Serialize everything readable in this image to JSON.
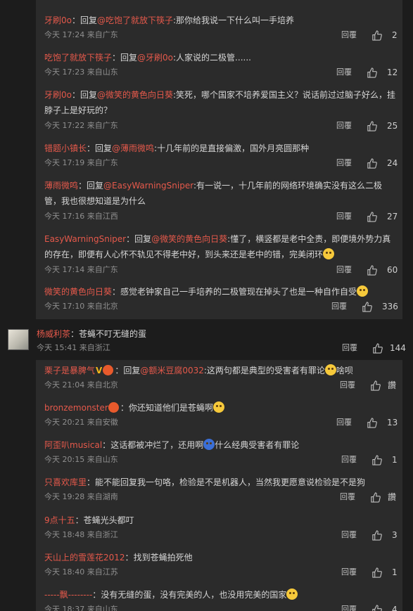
{
  "block1": {
    "replies": [
      {
        "user": "牙刷0o",
        "action": "：回复",
        "mention": "@吃饱了就放下筷子",
        "text": ":那你给我说一下什么叫一手培养",
        "time": "今天 17:24 来自广东",
        "reply_label": "回覆",
        "likes": "2"
      },
      {
        "user": "吃饱了就放下筷子",
        "action": "：回复",
        "mention": "@牙刷0o",
        "text": ":人家说的二极管......",
        "time": "今天 17:23 来自山东",
        "reply_label": "回覆",
        "likes": "12"
      },
      {
        "user": "牙刷0o",
        "action": "：回复",
        "mention": "@微笑的黄色向日葵",
        "text": ":笑死，哪个国家不培养爱国主义？说话前过过脑子好么，挂脖子上是好玩的？",
        "time": "今天 17:22 来自广东",
        "reply_label": "回覆",
        "likes": "25"
      },
      {
        "user": "错题小镇长",
        "action": "：回复",
        "mention": "@薄雨微鸣",
        "text": ":十几年前的是直接偏激，国外月亮圆那种",
        "time": "今天 17:19 来自广东",
        "reply_label": "回覆",
        "likes": "24"
      },
      {
        "user": "薄雨微鸣",
        "action": "：回复",
        "mention": "@EasyWarningSniper",
        "text": ":有一说一，十几年前的网络环境确实没有这么二极管，我也很想知道是为什么",
        "time": "今天 17:16 来自江西",
        "reply_label": "回覆",
        "likes": "27"
      },
      {
        "user": "EasyWarningSniper",
        "action": "：回复",
        "mention": "@微笑的黄色向日葵",
        "text": ":懂了，横竖都是老中全责，即便境外势力真的存在，即便有人心怀不轨见不得老中好，到头来还是老中的错，完美闭环",
        "time": "今天 17:14 来自广东",
        "reply_label": "回覆",
        "likes": "60"
      },
      {
        "user": "微笑的黄色向日葵",
        "action": "：",
        "mention": "",
        "text": "感觉老钟家自己一手培养的二极管现在掉头了也是一种自作自受",
        "time": "今天 17:10 来自北京",
        "reply_label": "回覆",
        "likes": "336"
      }
    ]
  },
  "top_comment": {
    "user": "杨威利茶",
    "text": "：苍蝇不叮无缝的蛋",
    "time": "今天 15:41 来自浙江",
    "reply_label": "回覆",
    "likes": "144"
  },
  "block2": {
    "replies": [
      {
        "user": "栗子是暴脾气",
        "action": "：回复",
        "mention": "@额米豆腐0032",
        "text": ":这两句都是典型的受害者有罪论",
        "tail": "啥呗",
        "time": "今天 21:04 来自北京",
        "reply_label": "回覆",
        "likes": "讚"
      },
      {
        "user": "bronzemonster",
        "action": "：",
        "mention": "",
        "text": "你还知道他们是苍蝇啊",
        "tail": "",
        "time": "今天 20:21 来自安徽",
        "reply_label": "回覆",
        "likes": "13"
      },
      {
        "user": "阿歪叭musical",
        "action": "：",
        "mention": "",
        "text": "这话都被冲烂了，还用啊",
        "tail": "什么经典受害者有罪论",
        "time": "今天 20:15 来自山东",
        "reply_label": "回覆",
        "likes": "1"
      },
      {
        "user": "只喜欢库里",
        "action": "：",
        "mention": "",
        "text": "能不能回复我一句咯，检验是不是机器人，当然我更愿意说检验是不是狗",
        "tail": "",
        "time": "今天 19:28 来自湖南",
        "reply_label": "回覆",
        "likes": "讚"
      },
      {
        "user": "9点十五",
        "action": "：",
        "mention": "",
        "text": "苍蝇光头都叮",
        "tail": "",
        "time": "今天 18:48 来自浙江",
        "reply_label": "回覆",
        "likes": "3"
      },
      {
        "user": "天山上的雪莲花2012",
        "action": "：",
        "mention": "",
        "text": "找到苍蝇拍死他",
        "tail": "",
        "time": "今天 18:40 来自江苏",
        "reply_label": "回覆",
        "likes": "1"
      },
      {
        "user": "-----飘--------",
        "action": "：",
        "mention": "",
        "text": "没有无缝的蛋，没有完美的人，也没用完美的国家",
        "tail": "",
        "time": "今天 18:37 来自山东",
        "reply_label": "回覆",
        "likes": "4"
      }
    ]
  }
}
